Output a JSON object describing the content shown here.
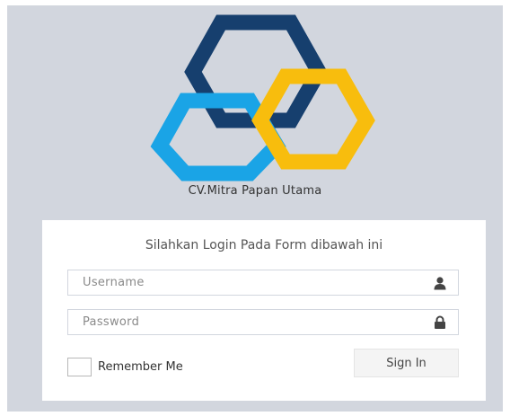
{
  "brand": {
    "name": "CV.Mitra Papan Utama",
    "colors": {
      "navy": "#163f6e",
      "blue": "#1aa4e6",
      "yellow": "#f8bd0d"
    },
    "logo_icon": "hexagon-rings-logo"
  },
  "page": {
    "background": "#d2d6de"
  },
  "login": {
    "message": "Silahkan Login Pada Form dibawah ini",
    "username": {
      "placeholder": "Username",
      "value": "",
      "icon": "user-icon"
    },
    "password": {
      "placeholder": "Password",
      "value": "",
      "icon": "lock-icon"
    },
    "remember_label": "Remember Me",
    "remember_checked": false,
    "submit_label": "Sign In"
  }
}
